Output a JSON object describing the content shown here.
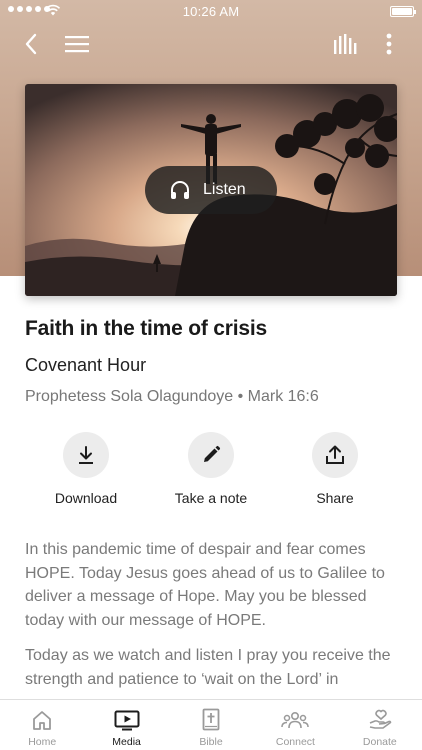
{
  "status_bar": {
    "time": "10:26 AM"
  },
  "top_bar": {
    "back_icon": "chevron-left-icon",
    "menu_icon": "hamburger-menu-icon",
    "audio_icon": "equalizer-bars-icon",
    "more_icon": "vertical-ellipsis-icon"
  },
  "hero": {
    "listen_label": "Listen",
    "listen_icon": "headphones-icon"
  },
  "sermon": {
    "title": "Faith in the time of crisis",
    "series": "Covenant Hour",
    "meta": "Prophetess Sola Olagundoye • Mark 16:6"
  },
  "actions": [
    {
      "label": "Download",
      "icon": "download-icon"
    },
    {
      "label": "Take a note",
      "icon": "pencil-icon"
    },
    {
      "label": "Share",
      "icon": "share-upload-icon"
    }
  ],
  "description": {
    "paragraph_1": "In this pandemic time of despair and fear comes HOPE. Today Jesus goes ahead of us to Galilee to deliver a message of Hope. May you be blessed today with our message of HOPE.",
    "paragraph_2": "Today as we watch and listen I pray you receive the strength and patience to ‘wait on the Lord’ in"
  },
  "tab_bar": {
    "active": "Media",
    "items": [
      {
        "label": "Home",
        "icon": "home-icon"
      },
      {
        "label": "Media",
        "icon": "tv-play-icon"
      },
      {
        "label": "Bible",
        "icon": "bible-cross-icon"
      },
      {
        "label": "Connect",
        "icon": "people-group-icon"
      },
      {
        "label": "Donate",
        "icon": "hand-heart-icon"
      }
    ]
  },
  "colors": {
    "accent_dark": "#1c1c1c",
    "muted_text": "#7a7a7a",
    "hero_tint": "#c8a791"
  }
}
